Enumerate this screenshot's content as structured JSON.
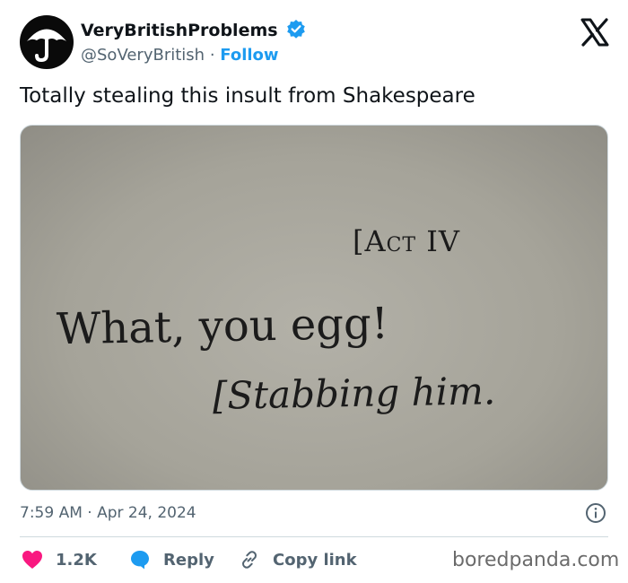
{
  "author": {
    "display_name": "VeryBritishProblems",
    "handle": "@SoVeryBritish",
    "separator": "·",
    "follow_label": "Follow"
  },
  "tweet": {
    "text": "Totally stealing this insult from Shakespeare",
    "time": "7:59 AM",
    "date_separator": "·",
    "date": "Apr 24, 2024"
  },
  "media": {
    "act_heading": "[Act IV",
    "line1": "What, you egg!",
    "line2": "[Stabbing him."
  },
  "actions": {
    "likes": "1.2K",
    "reply_label": "Reply",
    "copy_label": "Copy link"
  },
  "watermark": "boredpanda.com",
  "colors": {
    "accent": "#1d9bf0",
    "like": "#f91880",
    "text": "#0f1419",
    "muted": "#536471"
  },
  "icons": [
    "umbrella-avatar-icon",
    "verified-badge-icon",
    "x-logo-icon",
    "info-icon",
    "heart-icon",
    "reply-bubble-icon",
    "link-icon"
  ]
}
